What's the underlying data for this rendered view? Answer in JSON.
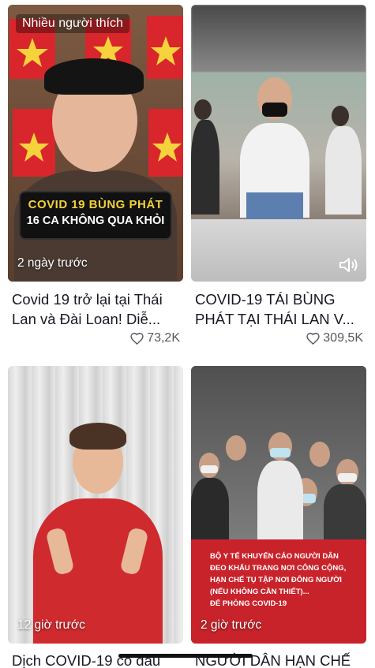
{
  "videos": [
    {
      "label": "Nhiều người thích",
      "overlay_line1": "COVID 19 BÙNG PHÁT",
      "overlay_line2": "16 CA KHÔNG QUA KHỎI",
      "time": "2 ngày trước",
      "caption": "Covid 19 trở lại tại Thái Lan và Đài Loan!  Diễ...",
      "likes": "73,2K"
    },
    {
      "time": "",
      "caption": "COVID-19 TÁI BÙNG PHÁT TẠI THÁI LAN V...",
      "likes": "309,5K",
      "sound": "speaker-icon"
    },
    {
      "time": "12 giờ trước",
      "caption": "Dịch COVID-19 có dấu"
    },
    {
      "time": "2 giờ trước",
      "caption": "NGƯỜI DÂN HẠN CHẾ",
      "overlay_text": [
        "BỘ Y TẾ KHUYẾN CÁO NGƯỜI DÂN",
        "ĐEO KHẨU TRANG NƠI CÔNG CỘNG,",
        "HẠN CHẾ TỤ TẬP NƠI ĐÔNG NGƯỜI",
        "(NẾU KHÔNG CẦN THIẾT)...",
        "ĐỂ PHÒNG COVID-19"
      ]
    }
  ],
  "colors": {
    "flag_red": "#d8262c",
    "flag_star": "#f6d33c",
    "overlay_red": "#c8232b",
    "text": "#161823",
    "muted": "#57575f"
  }
}
